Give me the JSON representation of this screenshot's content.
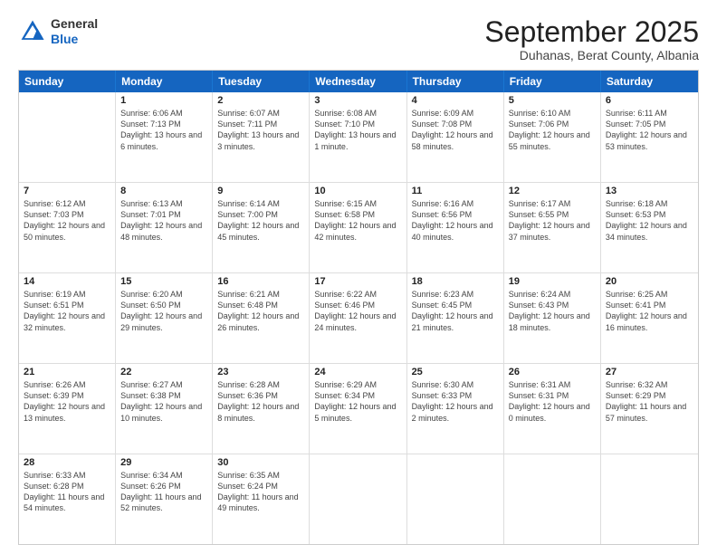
{
  "header": {
    "logo": {
      "general": "General",
      "blue": "Blue"
    },
    "title": "September 2025",
    "location": "Duhanas, Berat County, Albania"
  },
  "weekdays": [
    "Sunday",
    "Monday",
    "Tuesday",
    "Wednesday",
    "Thursday",
    "Friday",
    "Saturday"
  ],
  "weeks": [
    [
      {
        "day": "",
        "sunrise": "",
        "sunset": "",
        "daylight": ""
      },
      {
        "day": "1",
        "sunrise": "Sunrise: 6:06 AM",
        "sunset": "Sunset: 7:13 PM",
        "daylight": "Daylight: 13 hours and 6 minutes."
      },
      {
        "day": "2",
        "sunrise": "Sunrise: 6:07 AM",
        "sunset": "Sunset: 7:11 PM",
        "daylight": "Daylight: 13 hours and 3 minutes."
      },
      {
        "day": "3",
        "sunrise": "Sunrise: 6:08 AM",
        "sunset": "Sunset: 7:10 PM",
        "daylight": "Daylight: 13 hours and 1 minute."
      },
      {
        "day": "4",
        "sunrise": "Sunrise: 6:09 AM",
        "sunset": "Sunset: 7:08 PM",
        "daylight": "Daylight: 12 hours and 58 minutes."
      },
      {
        "day": "5",
        "sunrise": "Sunrise: 6:10 AM",
        "sunset": "Sunset: 7:06 PM",
        "daylight": "Daylight: 12 hours and 55 minutes."
      },
      {
        "day": "6",
        "sunrise": "Sunrise: 6:11 AM",
        "sunset": "Sunset: 7:05 PM",
        "daylight": "Daylight: 12 hours and 53 minutes."
      }
    ],
    [
      {
        "day": "7",
        "sunrise": "Sunrise: 6:12 AM",
        "sunset": "Sunset: 7:03 PM",
        "daylight": "Daylight: 12 hours and 50 minutes."
      },
      {
        "day": "8",
        "sunrise": "Sunrise: 6:13 AM",
        "sunset": "Sunset: 7:01 PM",
        "daylight": "Daylight: 12 hours and 48 minutes."
      },
      {
        "day": "9",
        "sunrise": "Sunrise: 6:14 AM",
        "sunset": "Sunset: 7:00 PM",
        "daylight": "Daylight: 12 hours and 45 minutes."
      },
      {
        "day": "10",
        "sunrise": "Sunrise: 6:15 AM",
        "sunset": "Sunset: 6:58 PM",
        "daylight": "Daylight: 12 hours and 42 minutes."
      },
      {
        "day": "11",
        "sunrise": "Sunrise: 6:16 AM",
        "sunset": "Sunset: 6:56 PM",
        "daylight": "Daylight: 12 hours and 40 minutes."
      },
      {
        "day": "12",
        "sunrise": "Sunrise: 6:17 AM",
        "sunset": "Sunset: 6:55 PM",
        "daylight": "Daylight: 12 hours and 37 minutes."
      },
      {
        "day": "13",
        "sunrise": "Sunrise: 6:18 AM",
        "sunset": "Sunset: 6:53 PM",
        "daylight": "Daylight: 12 hours and 34 minutes."
      }
    ],
    [
      {
        "day": "14",
        "sunrise": "Sunrise: 6:19 AM",
        "sunset": "Sunset: 6:51 PM",
        "daylight": "Daylight: 12 hours and 32 minutes."
      },
      {
        "day": "15",
        "sunrise": "Sunrise: 6:20 AM",
        "sunset": "Sunset: 6:50 PM",
        "daylight": "Daylight: 12 hours and 29 minutes."
      },
      {
        "day": "16",
        "sunrise": "Sunrise: 6:21 AM",
        "sunset": "Sunset: 6:48 PM",
        "daylight": "Daylight: 12 hours and 26 minutes."
      },
      {
        "day": "17",
        "sunrise": "Sunrise: 6:22 AM",
        "sunset": "Sunset: 6:46 PM",
        "daylight": "Daylight: 12 hours and 24 minutes."
      },
      {
        "day": "18",
        "sunrise": "Sunrise: 6:23 AM",
        "sunset": "Sunset: 6:45 PM",
        "daylight": "Daylight: 12 hours and 21 minutes."
      },
      {
        "day": "19",
        "sunrise": "Sunrise: 6:24 AM",
        "sunset": "Sunset: 6:43 PM",
        "daylight": "Daylight: 12 hours and 18 minutes."
      },
      {
        "day": "20",
        "sunrise": "Sunrise: 6:25 AM",
        "sunset": "Sunset: 6:41 PM",
        "daylight": "Daylight: 12 hours and 16 minutes."
      }
    ],
    [
      {
        "day": "21",
        "sunrise": "Sunrise: 6:26 AM",
        "sunset": "Sunset: 6:39 PM",
        "daylight": "Daylight: 12 hours and 13 minutes."
      },
      {
        "day": "22",
        "sunrise": "Sunrise: 6:27 AM",
        "sunset": "Sunset: 6:38 PM",
        "daylight": "Daylight: 12 hours and 10 minutes."
      },
      {
        "day": "23",
        "sunrise": "Sunrise: 6:28 AM",
        "sunset": "Sunset: 6:36 PM",
        "daylight": "Daylight: 12 hours and 8 minutes."
      },
      {
        "day": "24",
        "sunrise": "Sunrise: 6:29 AM",
        "sunset": "Sunset: 6:34 PM",
        "daylight": "Daylight: 12 hours and 5 minutes."
      },
      {
        "day": "25",
        "sunrise": "Sunrise: 6:30 AM",
        "sunset": "Sunset: 6:33 PM",
        "daylight": "Daylight: 12 hours and 2 minutes."
      },
      {
        "day": "26",
        "sunrise": "Sunrise: 6:31 AM",
        "sunset": "Sunset: 6:31 PM",
        "daylight": "Daylight: 12 hours and 0 minutes."
      },
      {
        "day": "27",
        "sunrise": "Sunrise: 6:32 AM",
        "sunset": "Sunset: 6:29 PM",
        "daylight": "Daylight: 11 hours and 57 minutes."
      }
    ],
    [
      {
        "day": "28",
        "sunrise": "Sunrise: 6:33 AM",
        "sunset": "Sunset: 6:28 PM",
        "daylight": "Daylight: 11 hours and 54 minutes."
      },
      {
        "day": "29",
        "sunrise": "Sunrise: 6:34 AM",
        "sunset": "Sunset: 6:26 PM",
        "daylight": "Daylight: 11 hours and 52 minutes."
      },
      {
        "day": "30",
        "sunrise": "Sunrise: 6:35 AM",
        "sunset": "Sunset: 6:24 PM",
        "daylight": "Daylight: 11 hours and 49 minutes."
      },
      {
        "day": "",
        "sunrise": "",
        "sunset": "",
        "daylight": ""
      },
      {
        "day": "",
        "sunrise": "",
        "sunset": "",
        "daylight": ""
      },
      {
        "day": "",
        "sunrise": "",
        "sunset": "",
        "daylight": ""
      },
      {
        "day": "",
        "sunrise": "",
        "sunset": "",
        "daylight": ""
      }
    ]
  ]
}
